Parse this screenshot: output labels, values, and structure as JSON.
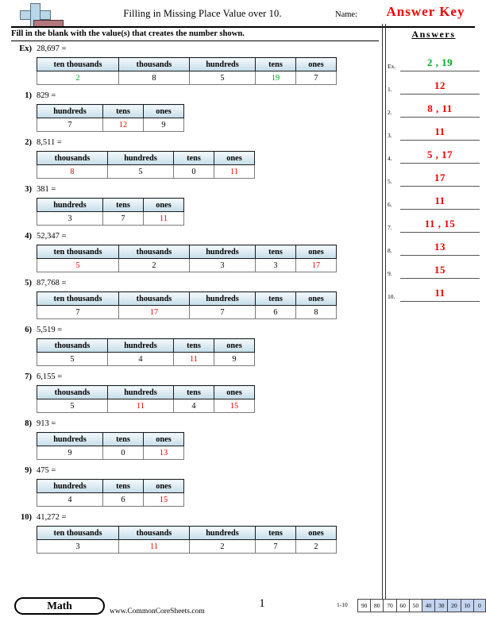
{
  "header": {
    "title": "Filling in Missing Place Value over 10.",
    "name_label": "Name:",
    "answer_key_text": "Answer Key",
    "instructions": "Fill in the blank with the value(s) that creates the number shown.",
    "logo_icon": "plus-book-logo"
  },
  "answer_colors": {
    "red": "#ee0000",
    "green": "#00aa22"
  },
  "problems": [
    {
      "num": "Ex)",
      "expression": "28,697 =",
      "headers": [
        "ten thousands",
        "thousands",
        "hundreds",
        "tens",
        "ones"
      ],
      "values": [
        "2",
        "8",
        "5",
        "19",
        "7"
      ],
      "answer_flags": [
        true,
        false,
        false,
        true,
        false
      ],
      "color": "green"
    },
    {
      "num": "1)",
      "expression": "829 =",
      "headers": [
        "hundreds",
        "tens",
        "ones"
      ],
      "values": [
        "7",
        "12",
        "9"
      ],
      "answer_flags": [
        false,
        true,
        false
      ],
      "color": "red"
    },
    {
      "num": "2)",
      "expression": "8,511 =",
      "headers": [
        "thousands",
        "hundreds",
        "tens",
        "ones"
      ],
      "values": [
        "8",
        "5",
        "0",
        "11"
      ],
      "answer_flags": [
        true,
        false,
        false,
        true
      ],
      "color": "red"
    },
    {
      "num": "3)",
      "expression": "381 =",
      "headers": [
        "hundreds",
        "tens",
        "ones"
      ],
      "values": [
        "3",
        "7",
        "11"
      ],
      "answer_flags": [
        false,
        false,
        true
      ],
      "color": "red"
    },
    {
      "num": "4)",
      "expression": "52,347 =",
      "headers": [
        "ten thousands",
        "thousands",
        "hundreds",
        "tens",
        "ones"
      ],
      "values": [
        "5",
        "2",
        "3",
        "3",
        "17"
      ],
      "answer_flags": [
        true,
        false,
        false,
        false,
        true
      ],
      "color": "red"
    },
    {
      "num": "5)",
      "expression": "87,768 =",
      "headers": [
        "ten thousands",
        "thousands",
        "hundreds",
        "tens",
        "ones"
      ],
      "values": [
        "7",
        "17",
        "7",
        "6",
        "8"
      ],
      "answer_flags": [
        false,
        true,
        false,
        false,
        false
      ],
      "color": "red"
    },
    {
      "num": "6)",
      "expression": "5,519 =",
      "headers": [
        "thousands",
        "hundreds",
        "tens",
        "ones"
      ],
      "values": [
        "5",
        "4",
        "11",
        "9"
      ],
      "answer_flags": [
        false,
        false,
        true,
        false
      ],
      "color": "red"
    },
    {
      "num": "7)",
      "expression": "6,155 =",
      "headers": [
        "thousands",
        "hundreds",
        "tens",
        "ones"
      ],
      "values": [
        "5",
        "11",
        "4",
        "15"
      ],
      "answer_flags": [
        false,
        true,
        false,
        true
      ],
      "color": "red"
    },
    {
      "num": "8)",
      "expression": "913 =",
      "headers": [
        "hundreds",
        "tens",
        "ones"
      ],
      "values": [
        "9",
        "0",
        "13"
      ],
      "answer_flags": [
        false,
        false,
        true
      ],
      "color": "red"
    },
    {
      "num": "9)",
      "expression": "475 =",
      "headers": [
        "hundreds",
        "tens",
        "ones"
      ],
      "values": [
        "4",
        "6",
        "15"
      ],
      "answer_flags": [
        false,
        false,
        true
      ],
      "color": "red"
    },
    {
      "num": "10)",
      "expression": "41,272 =",
      "headers": [
        "ten thousands",
        "thousands",
        "hundreds",
        "tens",
        "ones"
      ],
      "values": [
        "3",
        "11",
        "2",
        "7",
        "2"
      ],
      "answer_flags": [
        false,
        true,
        false,
        false,
        false
      ],
      "color": "red"
    }
  ],
  "answers_panel": {
    "title": "Answers",
    "rows": [
      {
        "index": "Ex.",
        "value": "2 , 19",
        "color": "green"
      },
      {
        "index": "1.",
        "value": "12",
        "color": "red"
      },
      {
        "index": "2.",
        "value": "8 , 11",
        "color": "red"
      },
      {
        "index": "3.",
        "value": "11",
        "color": "red"
      },
      {
        "index": "4.",
        "value": "5 , 17",
        "color": "red"
      },
      {
        "index": "5.",
        "value": "17",
        "color": "red"
      },
      {
        "index": "6.",
        "value": "11",
        "color": "red"
      },
      {
        "index": "7.",
        "value": "11 , 15",
        "color": "red"
      },
      {
        "index": "8.",
        "value": "13",
        "color": "red"
      },
      {
        "index": "9.",
        "value": "15",
        "color": "red"
      },
      {
        "index": "10.",
        "value": "11",
        "color": "red"
      }
    ]
  },
  "footer": {
    "subject_badge": "Math",
    "site_url": "www.CommonCoreSheets.com",
    "page_number": "1",
    "scale_label": "1-10",
    "scale_values": [
      "90",
      "80",
      "70",
      "60",
      "50",
      "40",
      "30",
      "20",
      "10",
      "0"
    ],
    "scale_highlighted": [
      "40",
      "30",
      "20",
      "10",
      "0"
    ]
  }
}
